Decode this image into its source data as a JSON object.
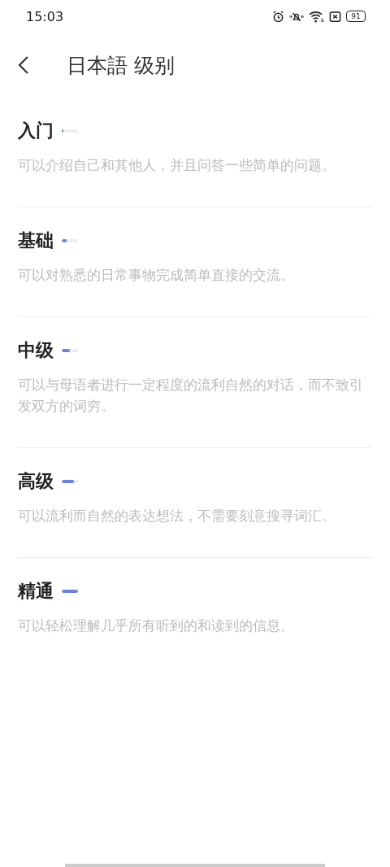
{
  "status_bar": {
    "time": "15:03",
    "battery": "91"
  },
  "header": {
    "title": "日本語 级别"
  },
  "levels": [
    {
      "name": "入门",
      "level": 0.1,
      "description": "可以介绍自己和其他人，并且问答一些简单的问题。"
    },
    {
      "name": "基础",
      "level": 0.3,
      "description": "可以对熟悉的日常事物完成简单直接的交流。"
    },
    {
      "name": "中级",
      "level": 0.5,
      "description": "可以与母语者进行一定程度的流利自然的对话，而不致引发双方的词穷。"
    },
    {
      "name": "高级",
      "level": 0.75,
      "description": "可以流利而自然的表达想法，不需要刻意搜寻词汇。"
    },
    {
      "name": "精通",
      "level": 1,
      "description": "可以轻松理解几乎所有听到的和读到的信息。"
    }
  ]
}
